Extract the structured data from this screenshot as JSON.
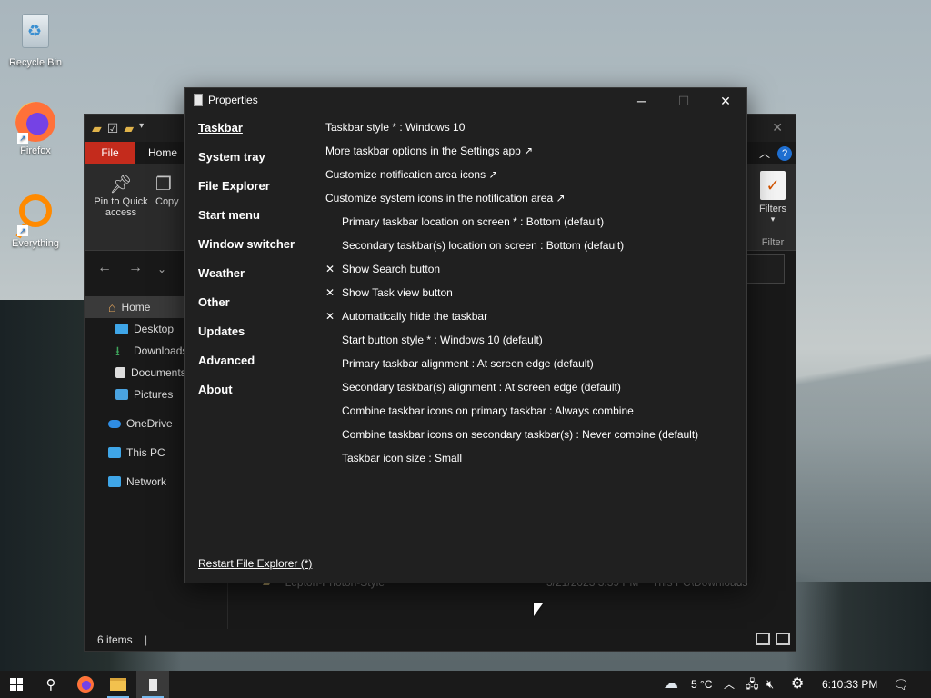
{
  "desktop": {
    "icons": [
      {
        "label": "Recycle Bin"
      },
      {
        "label": "Firefox"
      },
      {
        "label": "Everything"
      }
    ]
  },
  "explorer": {
    "tab_file": "File",
    "tab_home": "Home",
    "pin_label": "Pin to Quick access",
    "copy_label": "Copy",
    "filters_label": "Filters",
    "filter_group_label": "Filter",
    "nav_items": [
      {
        "label": "Home"
      },
      {
        "label": "Desktop"
      },
      {
        "label": "Downloads"
      },
      {
        "label": "Documents"
      },
      {
        "label": "Pictures"
      },
      {
        "label": "OneDrive"
      },
      {
        "label": "This PC"
      },
      {
        "label": "Network"
      }
    ],
    "file_row": {
      "name": "Lepton-Photon-Style",
      "date": "3/21/2023 3:39 PM",
      "location": "This PC\\Downloads"
    },
    "status": "6 items"
  },
  "dialog": {
    "title": "Properties",
    "sidebar": [
      "Taskbar",
      "System tray",
      "File Explorer",
      "Start menu",
      "Window switcher",
      "Weather",
      "Other",
      "Updates",
      "Advanced",
      "About"
    ],
    "items": [
      {
        "text": "Taskbar style * : Windows 10",
        "indent": false,
        "mark": ""
      },
      {
        "text": "More taskbar options in the Settings app ↗",
        "indent": false,
        "mark": ""
      },
      {
        "text": "Customize notification area icons ↗",
        "indent": false,
        "mark": ""
      },
      {
        "text": "Customize system icons in the notification area ↗",
        "indent": false,
        "mark": ""
      },
      {
        "text": "Primary taskbar location on screen * : Bottom (default)",
        "indent": true,
        "mark": ""
      },
      {
        "text": "Secondary taskbar(s) location on screen : Bottom (default)",
        "indent": true,
        "mark": ""
      },
      {
        "text": "Show Search button",
        "indent": false,
        "mark": "✕"
      },
      {
        "text": "Show Task view button",
        "indent": false,
        "mark": "✕"
      },
      {
        "text": "Automatically hide the taskbar",
        "indent": false,
        "mark": "✕"
      },
      {
        "text": "Start button style * : Windows 10 (default)",
        "indent": true,
        "mark": ""
      },
      {
        "text": "Primary taskbar alignment : At screen edge (default)",
        "indent": true,
        "mark": ""
      },
      {
        "text": "Secondary taskbar(s) alignment : At screen edge (default)",
        "indent": true,
        "mark": ""
      },
      {
        "text": "Combine taskbar icons on primary taskbar : Always combine",
        "indent": true,
        "mark": ""
      },
      {
        "text": "Combine taskbar icons on secondary taskbar(s) : Never combine (default)",
        "indent": true,
        "mark": ""
      },
      {
        "text": "Taskbar icon size : Small",
        "indent": true,
        "mark": ""
      }
    ],
    "restart_link": "Restart File Explorer (*)"
  },
  "taskbar": {
    "weather": "5 °C",
    "time": "6:10:33 PM"
  }
}
